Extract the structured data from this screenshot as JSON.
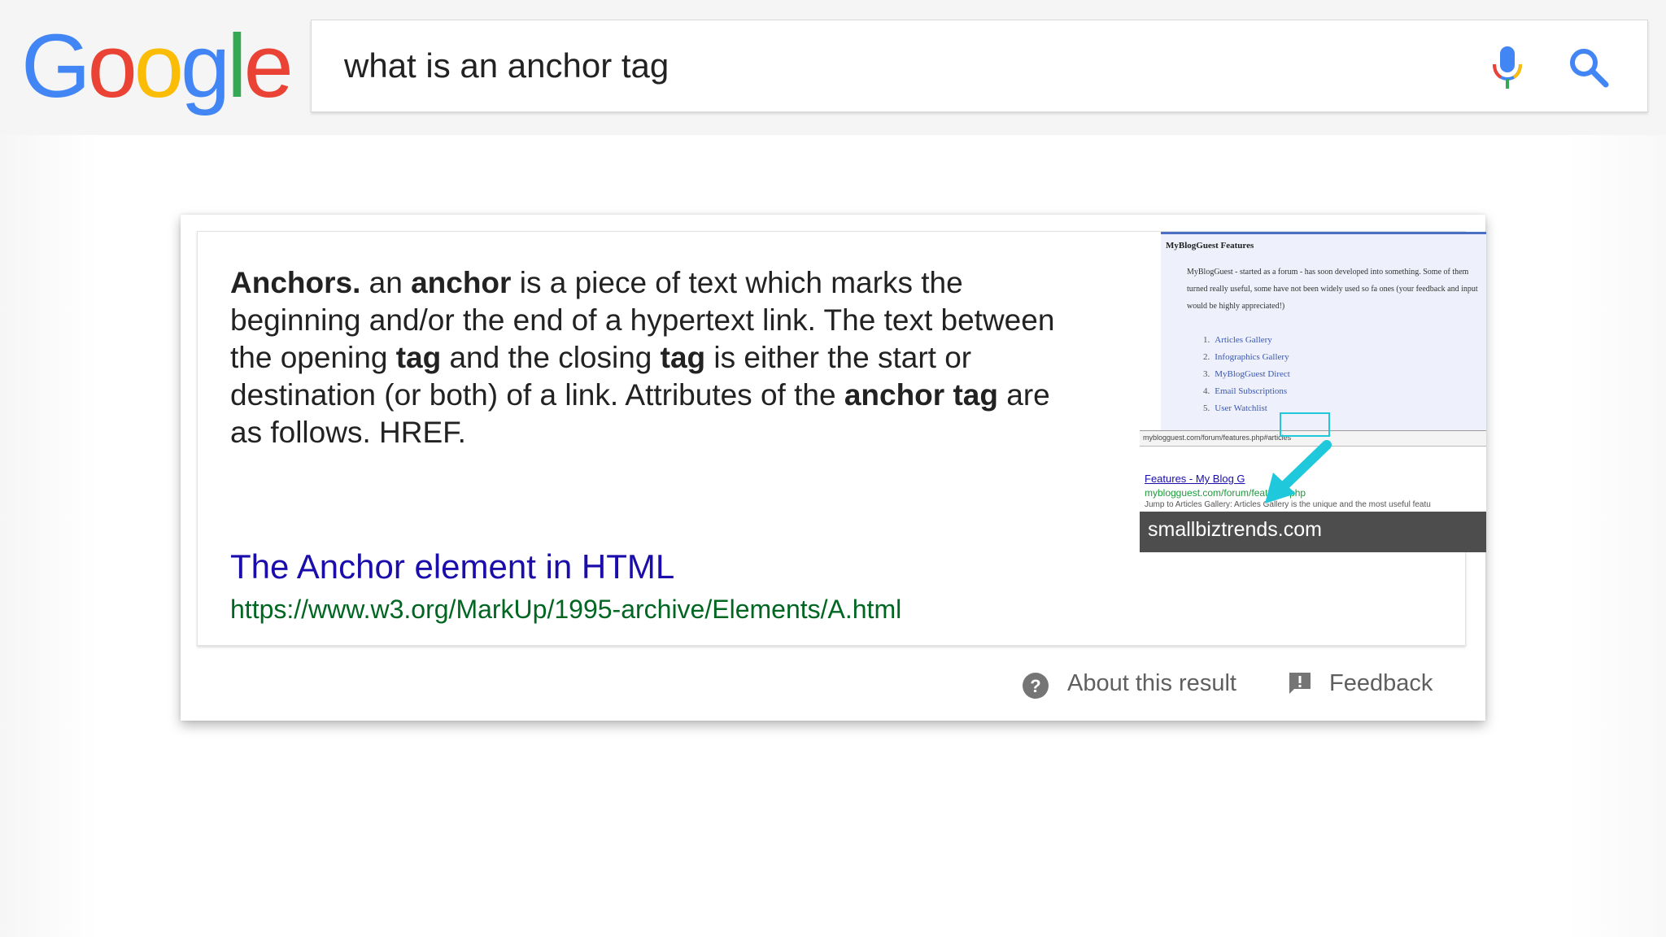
{
  "header": {
    "logo_letters": [
      {
        "char": "G",
        "color": "#4285F4"
      },
      {
        "char": "o",
        "color": "#EA4335"
      },
      {
        "char": "o",
        "color": "#FBBC05"
      },
      {
        "char": "g",
        "color": "#4285F4"
      },
      {
        "char": "l",
        "color": "#34A853"
      },
      {
        "char": "e",
        "color": "#EA4335"
      }
    ],
    "search": {
      "value": "what is an anchor tag"
    },
    "icons": {
      "mic": "microphone-icon",
      "search": "magnifier-icon"
    }
  },
  "snippet": {
    "text_runs": [
      {
        "t": "Anchors.",
        "b": true
      },
      {
        "t": " an ",
        "b": false
      },
      {
        "t": "anchor",
        "b": true
      },
      {
        "t": " is a piece of text which marks the beginning and/or the end of a hypertext link. The text between the opening ",
        "b": false
      },
      {
        "t": "tag",
        "b": true
      },
      {
        "t": " and the closing ",
        "b": false
      },
      {
        "t": "tag",
        "b": true
      },
      {
        "t": " is either the start or destination (or both) of a link. Attributes of the ",
        "b": false
      },
      {
        "t": "anchor tag",
        "b": true
      },
      {
        "t": " are as follows. HREF.",
        "b": false
      }
    ],
    "result_title": "The Anchor element in HTML",
    "result_url": "https://www.w3.org/MarkUp/1995-archive/Elements/A.html",
    "thumbnail": {
      "heading": "MyBlogGuest Features",
      "paragraph": "MyBlogGuest - started as a forum - has soon developed into something. Some of them turned really useful, some have not been widely used so fa ones (your feedback and input would be highly appreciated!)",
      "list": [
        {
          "num": "1.",
          "label": "Articles Gallery"
        },
        {
          "num": "2.",
          "label": "Infographics Gallery"
        },
        {
          "num": "3.",
          "label": "MyBlogGuest Direct"
        },
        {
          "num": "4.",
          "label": "Email Subscriptions"
        },
        {
          "num": "5.",
          "label": "User Watchlist"
        }
      ],
      "url_bar": "myblogguest.com/forum/features.php#articles",
      "serp_title": "Features - My Blog G",
      "serp_url": "myblogguest.com/forum/features.php",
      "serp_desc": "Jump to Articles Gallery: Articles Gallery is the unique and the most useful featu",
      "source": "smallbiztrends.com",
      "accent_color": "#20c8dc"
    },
    "footer": {
      "about_label": "About this result",
      "feedback_label": "Feedback"
    }
  }
}
